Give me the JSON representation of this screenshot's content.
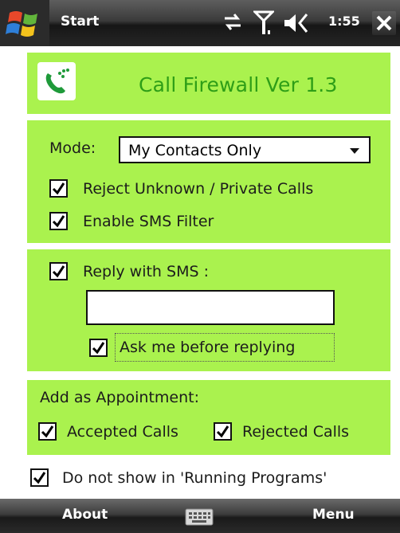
{
  "titlebar": {
    "start_label": "Start",
    "time": "1:55",
    "icons": [
      "windows-flag-icon",
      "connectivity-icon",
      "signal-icon",
      "volume-icon",
      "close-icon"
    ]
  },
  "app": {
    "title": "Call Firewall Ver 1.3",
    "icon": "phone-call-icon"
  },
  "settings": {
    "mode_label": "Mode:",
    "mode_value": "My Contacts Only",
    "reject_unknown_label": "Reject Unknown / Private Calls",
    "reject_unknown_checked": true,
    "sms_filter_label": "Enable SMS Filter",
    "sms_filter_checked": true
  },
  "reply": {
    "reply_sms_label": "Reply with SMS :",
    "reply_sms_checked": true,
    "message_value": "",
    "ask_before_label": "Ask me before replying",
    "ask_before_checked": true
  },
  "appointment": {
    "heading": "Add as Appointment:",
    "accepted_label": "Accepted Calls",
    "accepted_checked": true,
    "rejected_label": "Rejected Calls",
    "rejected_checked": true
  },
  "running_programs": {
    "label": "Do not show in 'Running Programs'",
    "checked": true
  },
  "softkeys": {
    "left": "About",
    "right": "Menu",
    "center_icon": "keyboard-icon"
  },
  "colors": {
    "panel_green": "#aaf24e",
    "title_green": "#2e9e17"
  }
}
